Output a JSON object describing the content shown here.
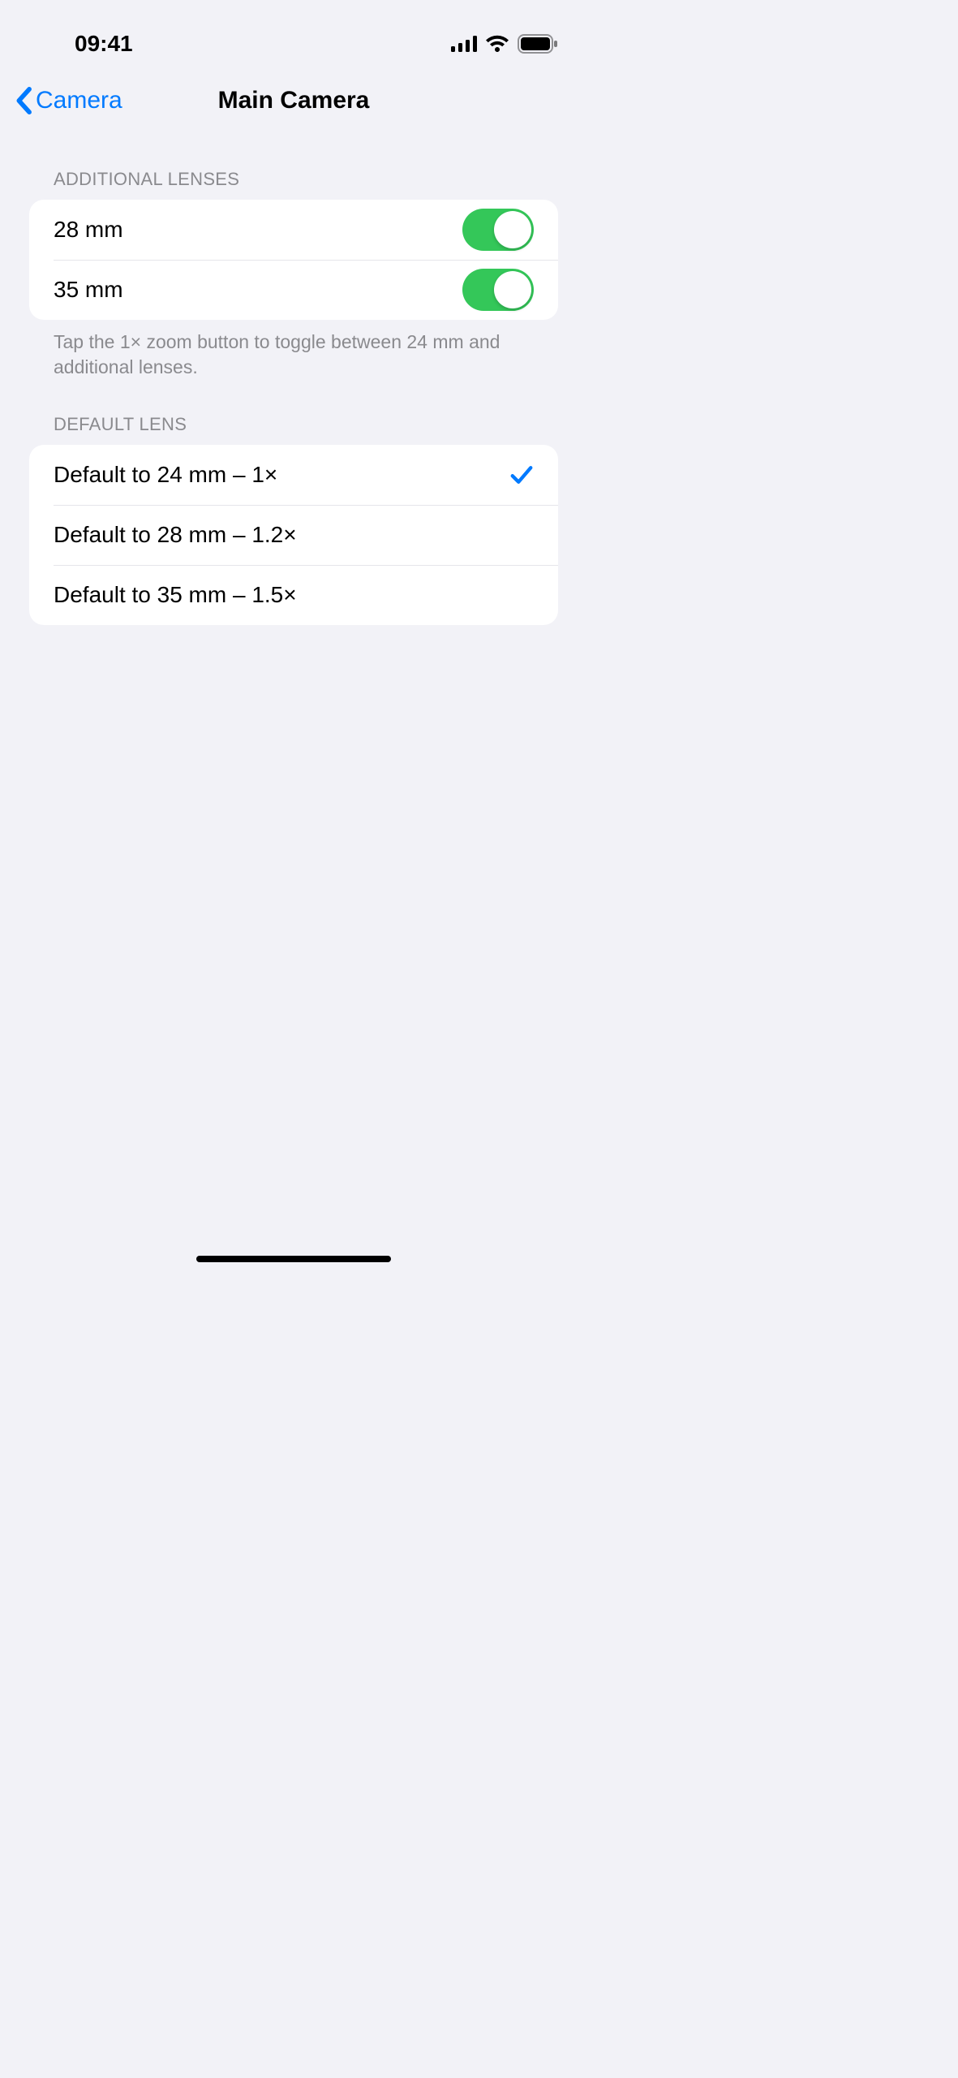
{
  "status": {
    "time": "09:41"
  },
  "nav": {
    "back_label": "Camera",
    "title": "Main Camera"
  },
  "sections": {
    "additional": {
      "header": "ADDITIONAL LENSES",
      "rows": [
        {
          "label": "28 mm",
          "on": true
        },
        {
          "label": "35 mm",
          "on": true
        }
      ],
      "footer": "Tap the 1× zoom button to toggle between 24 mm and additional lenses."
    },
    "default_lens": {
      "header": "DEFAULT LENS",
      "rows": [
        {
          "label": "Default to 24 mm – 1×",
          "selected": true
        },
        {
          "label": "Default to 28 mm – 1.2×",
          "selected": false
        },
        {
          "label": "Default to 35 mm – 1.5×",
          "selected": false
        }
      ]
    }
  }
}
